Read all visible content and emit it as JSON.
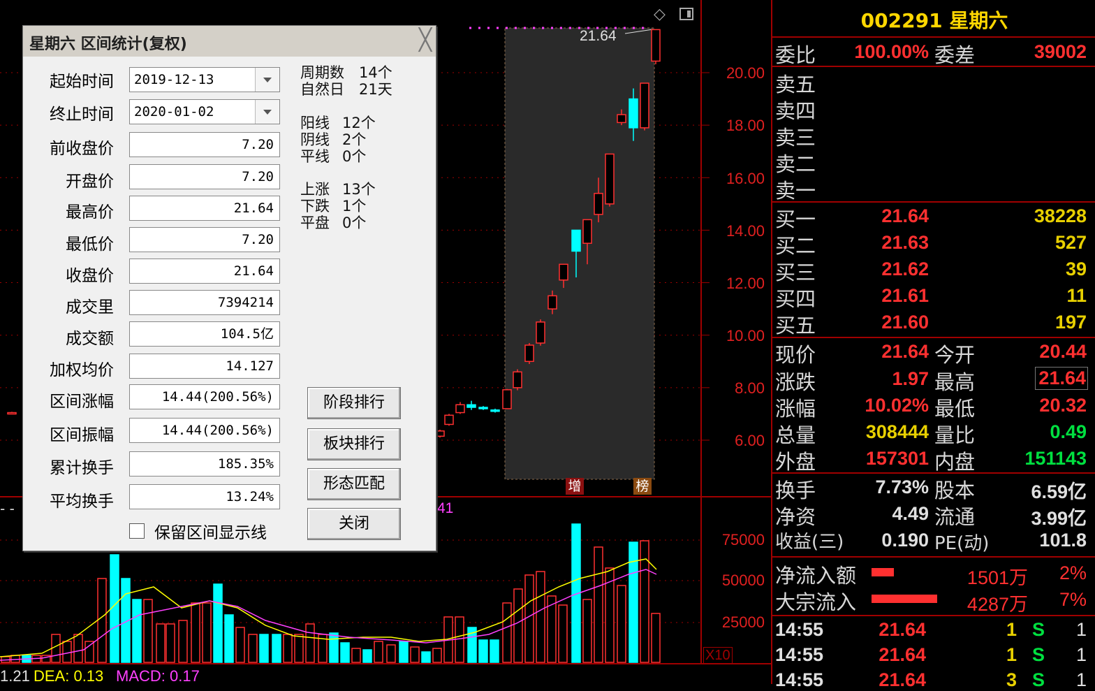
{
  "chart": {
    "price_axis_labels": [
      "20.00",
      "18.00",
      "16.00",
      "14.00",
      "12.00",
      "10.00",
      "8.00",
      "6.00"
    ],
    "volume_axis_labels": [
      "75000",
      "50000",
      "25000"
    ],
    "last_price_label": "21.64",
    "badge_zeng": "增",
    "badge_bang": "榜",
    "x10_label": "X10",
    "indicator_fragment": "41",
    "macd_line": {
      "diff": "1.21",
      "dea_label": "DEA: 0.13",
      "macd_label": "MACD: 0.17"
    },
    "colors": {
      "up": "#ff3030",
      "down": "#00ffff",
      "ma_yellow": "#ffff00",
      "ma_magenta": "#ff40ff",
      "grid": "#a00000"
    }
  },
  "dialog": {
    "title": "星期六 区间统计(复权)",
    "fields": [
      {
        "label": "起始时间",
        "value": "2019-12-13"
      },
      {
        "label": "终止时间",
        "value": "2020-01-02"
      },
      {
        "label": "前收盘价",
        "value": "7.20"
      },
      {
        "label": "开盘价",
        "value": "7.20"
      },
      {
        "label": "最高价",
        "value": "21.64"
      },
      {
        "label": "最低价",
        "value": "7.20"
      },
      {
        "label": "收盘价",
        "value": "21.64"
      },
      {
        "label": "成交里",
        "value": "7394214"
      },
      {
        "label": "成交额",
        "value": "104.5亿"
      },
      {
        "label": "加权均价",
        "value": "14.127"
      },
      {
        "label": "区间涨幅",
        "value": "14.44(200.56%)"
      },
      {
        "label": "区间振幅",
        "value": "14.44(200.56%)"
      },
      {
        "label": "累计换手",
        "value": "185.35%"
      },
      {
        "label": "平均换手",
        "value": "13.24%"
      }
    ],
    "stats": {
      "period_label": "周期数",
      "period_value": "14个",
      "natural_label": "自然日",
      "natural_value": "21天",
      "yang_label": "阳线",
      "yang_value": "12个",
      "yin_label": "阴线",
      "yin_value": "2个",
      "flat_label": "平线",
      "flat_value": "0个",
      "up_label": "上涨",
      "up_value": "13个",
      "down_label": "下跌",
      "down_value": "1个",
      "even_label": "平盘",
      "even_value": "0个"
    },
    "buttons": [
      "阶段排行",
      "板块排行",
      "形态匹配",
      "关闭"
    ],
    "checkbox_label": "保留区间显示线"
  },
  "quote": {
    "title": "002291 星期六",
    "weibi_label": "委比",
    "weibi_value": "100.00%",
    "weicha_label": "委差",
    "weicha_value": "39002",
    "sells": [
      "卖五",
      "卖四",
      "卖三",
      "卖二",
      "卖一"
    ],
    "buys": [
      {
        "label": "买一",
        "price": "21.64",
        "vol": "38228"
      },
      {
        "label": "买二",
        "price": "21.63",
        "vol": "527"
      },
      {
        "label": "买三",
        "price": "21.62",
        "vol": "39"
      },
      {
        "label": "买四",
        "price": "21.61",
        "vol": "11"
      },
      {
        "label": "买五",
        "price": "21.60",
        "vol": "197"
      }
    ],
    "stats": [
      {
        "l1": "现价",
        "v1": "21.64",
        "l2": "今开",
        "v2": "20.44"
      },
      {
        "l1": "涨跌",
        "v1": "1.97",
        "l2": "最高",
        "v2": "21.64"
      },
      {
        "l1": "涨幅",
        "v1": "10.02%",
        "l2": "最低",
        "v2": "20.32"
      },
      {
        "l1": "总量",
        "v1": "308444",
        "l2": "量比",
        "v2": "0.49"
      },
      {
        "l1": "外盘",
        "v1": "157301",
        "l2": "内盘",
        "v2": "151143"
      }
    ],
    "info": [
      {
        "l1": "换手",
        "v1": "7.73%",
        "l2": "股本",
        "v2": "6.59亿"
      },
      {
        "l1": "净资",
        "v1": "4.49",
        "l2": "流通",
        "v2": "3.99亿"
      },
      {
        "l1": "收益(三)",
        "v1": "0.190",
        "l2": "PE(动)",
        "v2": "101.8"
      }
    ],
    "flows": [
      {
        "label": "净流入额",
        "value": "1501万",
        "pct": "2%"
      },
      {
        "label": "大宗流入",
        "value": "4287万",
        "pct": "7%"
      }
    ],
    "ticks": [
      {
        "time": "14:55",
        "price": "21.64",
        "vol": "1",
        "side": "S",
        "n": "1"
      },
      {
        "time": "14:55",
        "price": "21.64",
        "vol": "1",
        "side": "S",
        "n": "1"
      },
      {
        "time": "14:55",
        "price": "21.64",
        "vol": "3",
        "side": "S",
        "n": "1"
      }
    ]
  }
}
